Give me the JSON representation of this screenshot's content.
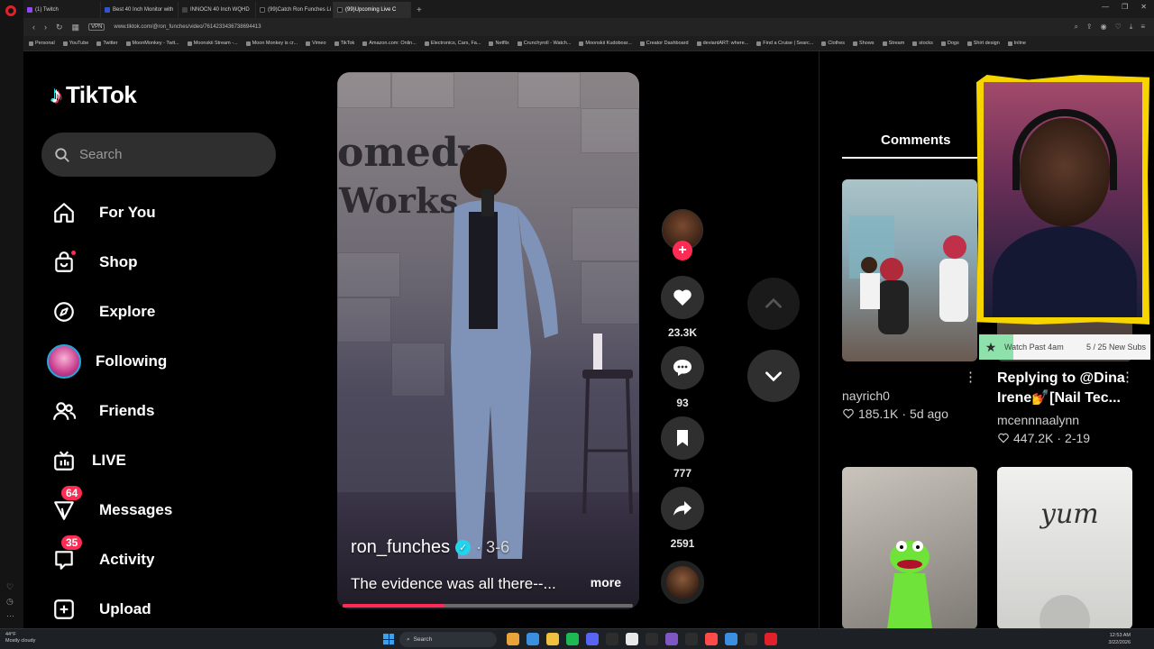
{
  "browser": {
    "tabs": [
      {
        "label": "(1) Twitch"
      },
      {
        "label": "Best 40 Inch Monitor with"
      },
      {
        "label": "INNOCN 40 Inch WQHD"
      },
      {
        "label": "(99)Catch Ron Funches Li"
      },
      {
        "label": "(99)Upcoming Live C"
      }
    ],
    "vpn_label": "VPN",
    "url": "www.tiktok.com/@ron_funches/video/7614233436738694413",
    "bookmarks": [
      "Personal",
      "YouTube",
      "Twitter",
      "MoonMonkey - Twit...",
      "Moonskii Stream -...",
      "Moon Monkey is cr...",
      "Vimeo",
      "TikTok",
      "Amazon.com: Onlin...",
      "Electronics, Cars, Fa...",
      "Netflix",
      "Crunchyroll - Watch...",
      "Moonskii Kudoboar...",
      "Creator Dashboard",
      "deviantART: where...",
      "Find a Cruise | Searc...",
      "Clothes",
      "Shows",
      "Stream",
      "stocks",
      "Dogs",
      "Shirt design",
      "Inline"
    ]
  },
  "tiktok": {
    "logo_text": "TikTok",
    "search_placeholder": "Search",
    "nav": [
      {
        "label": "For You"
      },
      {
        "label": "Shop"
      },
      {
        "label": "Explore"
      },
      {
        "label": "Following"
      },
      {
        "label": "Friends"
      },
      {
        "label": "LIVE"
      },
      {
        "label": "Messages",
        "badge": "64"
      },
      {
        "label": "Activity",
        "badge": "35"
      },
      {
        "label": "Upload"
      }
    ]
  },
  "video": {
    "sign_line1": "omedy",
    "sign_line2": "Works",
    "username": "ron_funches",
    "date": "· 3-6",
    "caption": "The evidence was all there--...",
    "more_label": "more",
    "progress": 0.35,
    "likes": "23.3K",
    "comments": "93",
    "saves": "777",
    "shares": "2591"
  },
  "right_panel": {
    "comments_tab": "Comments",
    "videos": [
      {
        "user": "nayrich0",
        "likes": "185.1K",
        "age": "5d ago",
        "title": ""
      },
      {
        "user": "mcennnaalynn",
        "likes": "447.2K",
        "age": "2-19",
        "title_line1": "Replying to @Dina",
        "title_line2": "Irene💅[Nail Tec..."
      }
    ],
    "thumb4_text": "yum"
  },
  "overlay": {
    "sub_goal_text": "Watch Past 4am",
    "sub_goal_count": "5 / 25 New Subs",
    "sub_goal_progress": 0.2
  },
  "taskbar": {
    "weather_temp": "44°F",
    "weather_desc": "Mostly cloudy",
    "search_label": "Search",
    "time": "12:53 AM",
    "date": "3/22/2026"
  },
  "colors": {
    "accent": "#fe2c55",
    "verified": "#20d5ec",
    "webcam_frame": "#f5d400"
  }
}
